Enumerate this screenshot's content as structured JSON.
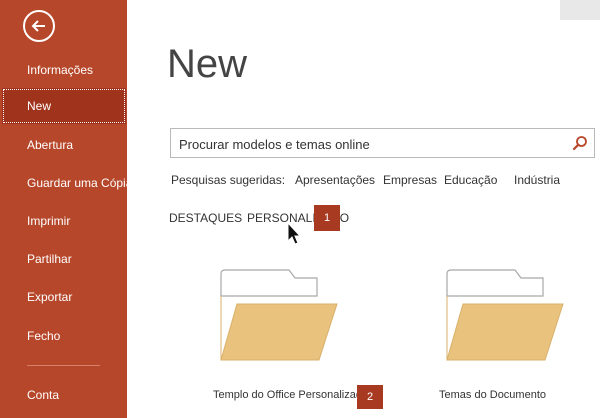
{
  "sidebar": {
    "back_icon": "back-arrow-icon",
    "items": [
      {
        "label": "Informações",
        "active": false
      },
      {
        "label": "New",
        "active": true
      },
      {
        "label": "Abertura",
        "active": false
      },
      {
        "label": "Guardar uma Cópia",
        "active": false
      },
      {
        "label": "Imprimir",
        "active": false
      },
      {
        "label": "Partilhar",
        "active": false
      },
      {
        "label": "Exportar",
        "active": false
      },
      {
        "label": "Fecho",
        "active": false
      },
      {
        "label": "Conta",
        "active": false
      }
    ],
    "color": "#b7472a",
    "active_color": "#a0331c"
  },
  "main": {
    "title": "New",
    "search": {
      "value": "",
      "placeholder": "Procurar modelos e temas online",
      "icon": "search-icon"
    },
    "suggested": {
      "label": "Pesquisas sugeridas:",
      "items": [
        "Apresentações",
        "Empresas",
        "Educação",
        "Indústria"
      ]
    },
    "tabs": [
      {
        "label": "DESTAQUES",
        "active": false
      },
      {
        "label": "PERSONALIZADO",
        "active": true
      }
    ],
    "callouts": [
      "1",
      "2"
    ],
    "templates": [
      {
        "label": "Templo do Office Personalizado",
        "icon": "folder-icon"
      },
      {
        "label": "Temas do Documento",
        "icon": "folder-icon"
      }
    ],
    "accent_color": "#a93a22",
    "folder_color": "#e9c27d"
  }
}
